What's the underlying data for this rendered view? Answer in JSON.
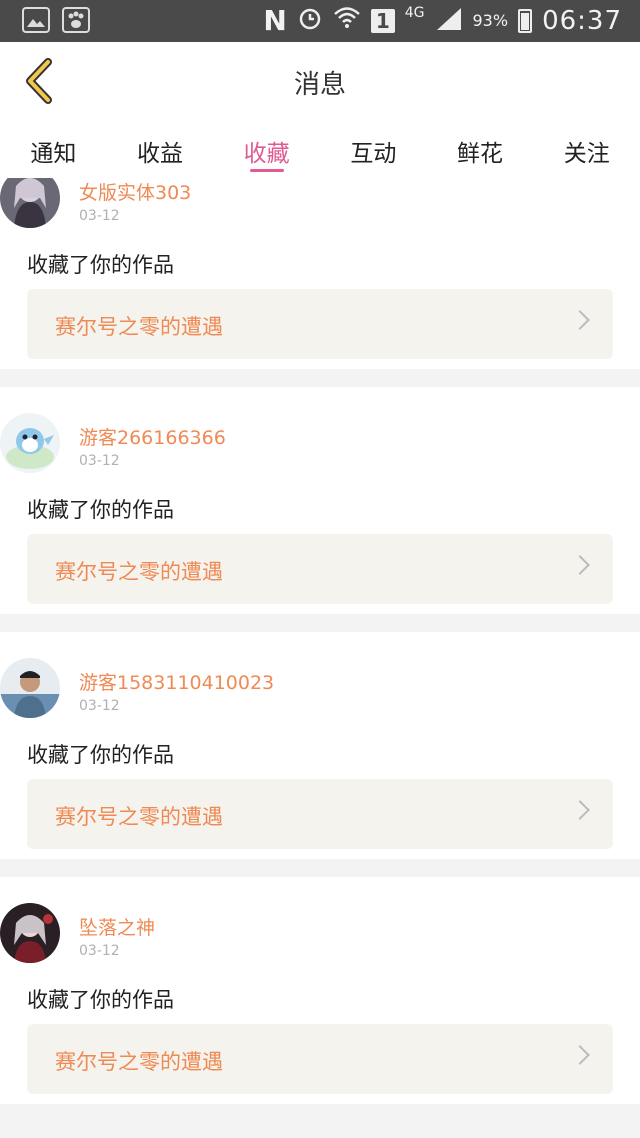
{
  "status_bar": {
    "network_label": "N",
    "sim_label": "1",
    "lte_label": "4G",
    "battery": "93%",
    "time": "06:37"
  },
  "header": {
    "title": "消息"
  },
  "tabs": [
    {
      "label": "通知"
    },
    {
      "label": "收益"
    },
    {
      "label": "收藏"
    },
    {
      "label": "互动"
    },
    {
      "label": "鲜花"
    },
    {
      "label": "关注"
    }
  ],
  "active_tab": "收藏",
  "colors": {
    "accent": "#e05a94",
    "username": "#f08a54"
  },
  "notifications": [
    {
      "username": "女版实体303",
      "date": "03-12",
      "action": "收藏了你的作品",
      "work_title": "赛尔号之零的遭遇"
    },
    {
      "username": "游客266166366",
      "date": "03-12",
      "action": "收藏了你的作品",
      "work_title": "赛尔号之零的遭遇"
    },
    {
      "username": "游客15831104100​23",
      "date": "03-12",
      "action": "收藏了你的作品",
      "work_title": "赛尔号之零的遭遇"
    },
    {
      "username": "坠落之神",
      "date": "03-12",
      "action": "收藏了你的作品",
      "work_title": "赛尔号之零的遭遇"
    }
  ]
}
